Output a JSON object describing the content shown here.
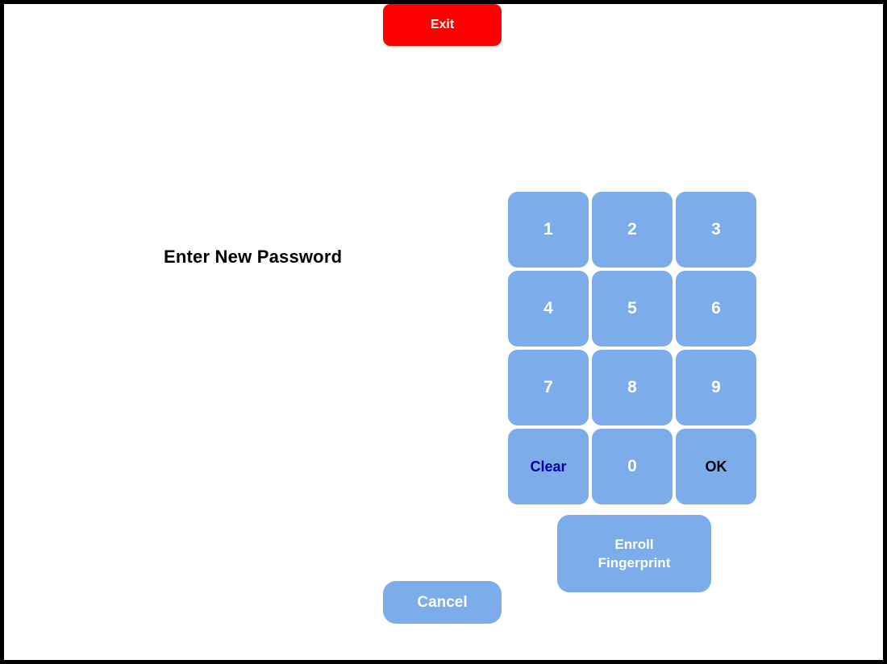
{
  "screen": {
    "name": "enter-new-password",
    "background_color": "#ffffff",
    "border_color": "#000000"
  },
  "colors": {
    "key_blue": "#7cace9",
    "exit_red": "#ff0000",
    "clear_text": "#0000a0",
    "ok_text": "#000000",
    "key_text": "#ffffff",
    "prompt_text": "#000000"
  },
  "header": {
    "exit_label": "Exit"
  },
  "prompt": {
    "label": "Enter New Password"
  },
  "keypad": {
    "keys": [
      {
        "label": "1",
        "role": "digit"
      },
      {
        "label": "2",
        "role": "digit"
      },
      {
        "label": "3",
        "role": "digit"
      },
      {
        "label": "4",
        "role": "digit"
      },
      {
        "label": "5",
        "role": "digit"
      },
      {
        "label": "6",
        "role": "digit"
      },
      {
        "label": "7",
        "role": "digit"
      },
      {
        "label": "8",
        "role": "digit"
      },
      {
        "label": "9",
        "role": "digit"
      },
      {
        "label": "Clear",
        "role": "clear"
      },
      {
        "label": "0",
        "role": "digit"
      },
      {
        "label": "OK",
        "role": "confirm"
      }
    ]
  },
  "actions": {
    "enroll_line1": "Enroll",
    "enroll_line2": "Fingerprint",
    "cancel_label": "Cancel"
  }
}
